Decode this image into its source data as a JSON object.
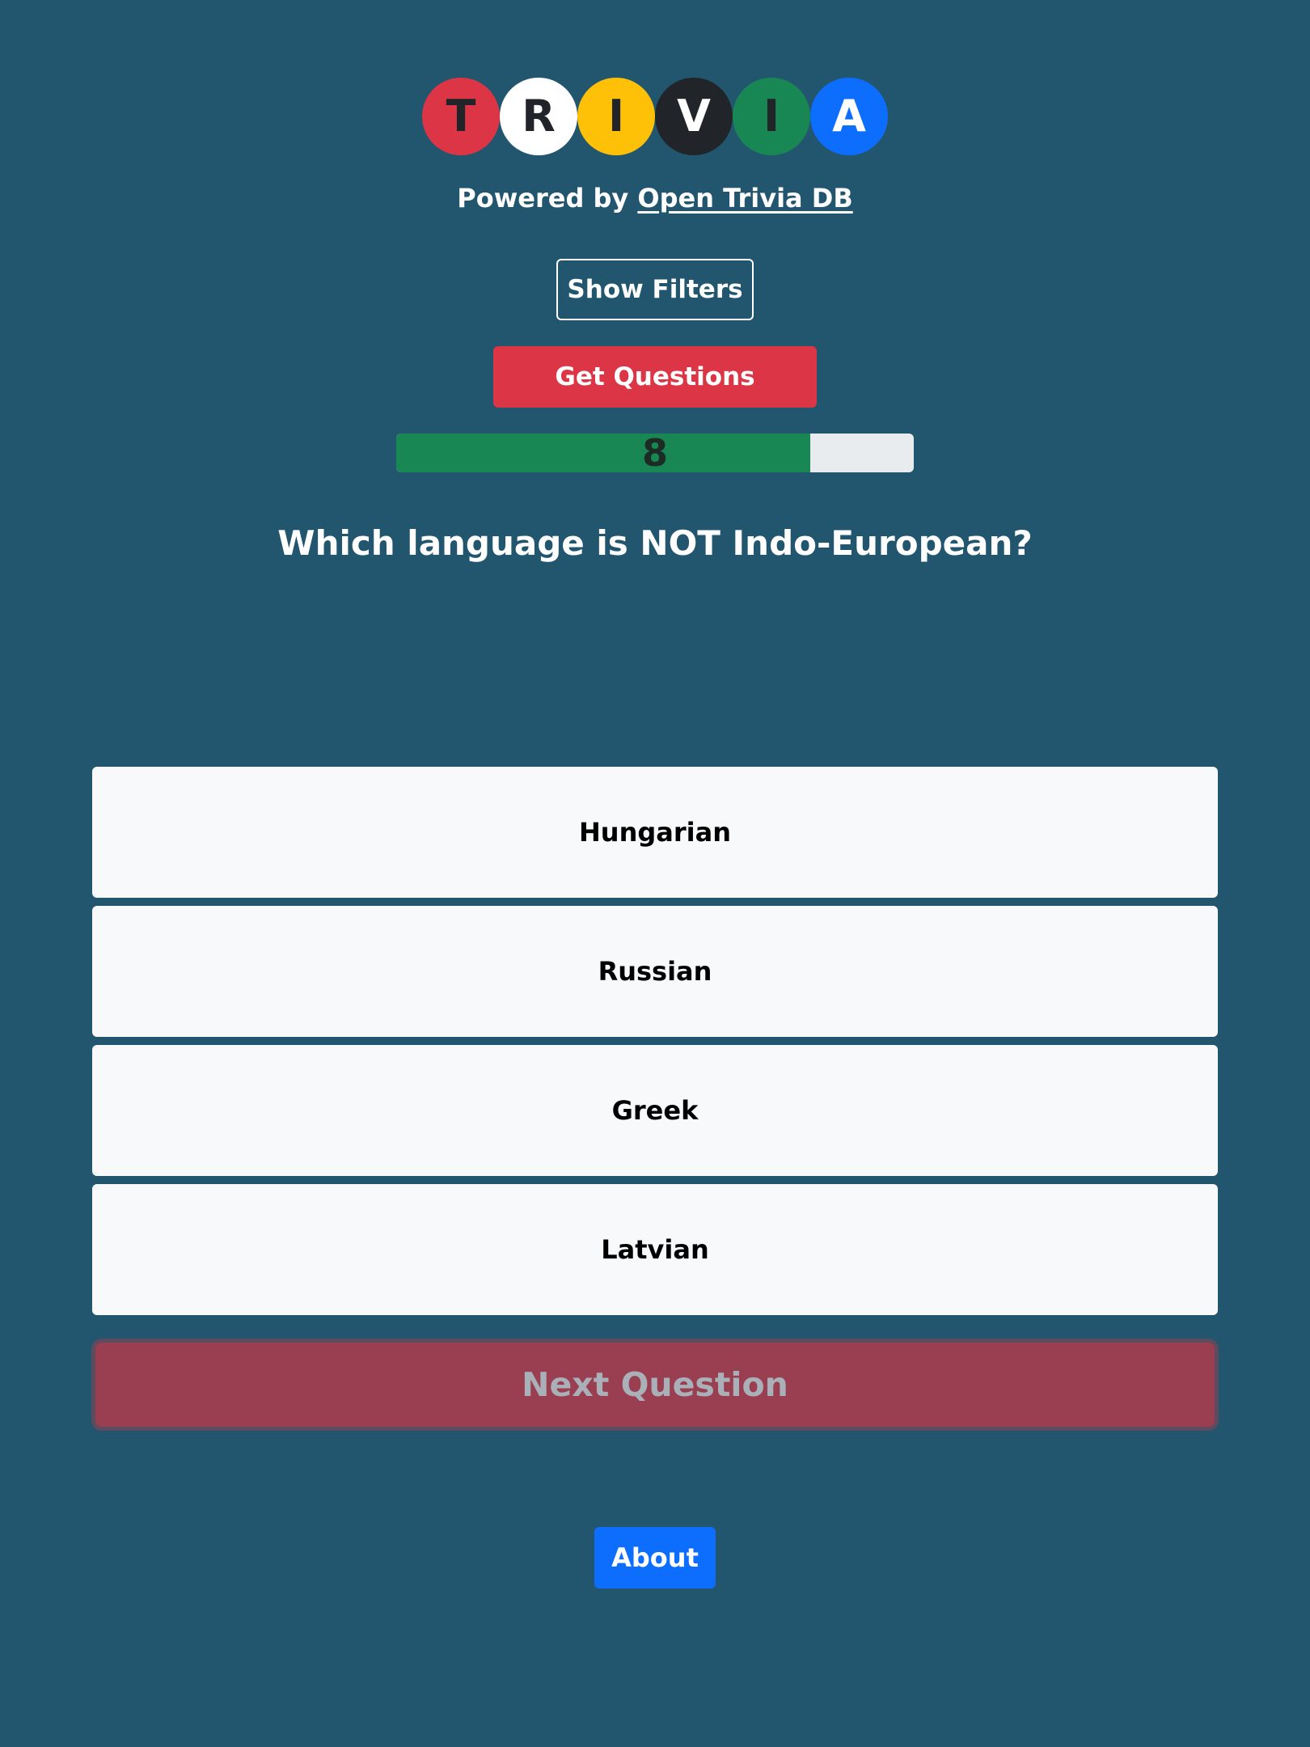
{
  "logo": {
    "letters": [
      {
        "char": "T",
        "bg": "#dc3545",
        "fg": "#212529"
      },
      {
        "char": "R",
        "bg": "#ffffff",
        "fg": "#212529"
      },
      {
        "char": "I",
        "bg": "#ffc107",
        "fg": "#212529"
      },
      {
        "char": "V",
        "bg": "#212529",
        "fg": "#ffffff"
      },
      {
        "char": "I",
        "bg": "#198754",
        "fg": "#212529"
      },
      {
        "char": "A",
        "bg": "#0d6efd",
        "fg": "#ffffff"
      }
    ]
  },
  "powered": {
    "prefix": "Powered by",
    "link_text": "Open Trivia DB"
  },
  "buttons": {
    "filters": "Show Filters",
    "get_questions": "Get Questions",
    "next_question": "Next Question",
    "about": "About"
  },
  "progress": {
    "label": "8",
    "fraction": 0.8
  },
  "question": {
    "text": "Which language is NOT Indo-European?",
    "answers": [
      "Hungarian",
      "Russian",
      "Greek",
      "Latvian"
    ]
  },
  "colors": {
    "background": "#22566e",
    "danger": "#dc3545",
    "success": "#198754",
    "primary": "#0d6efd",
    "light": "#f8f9fa"
  }
}
